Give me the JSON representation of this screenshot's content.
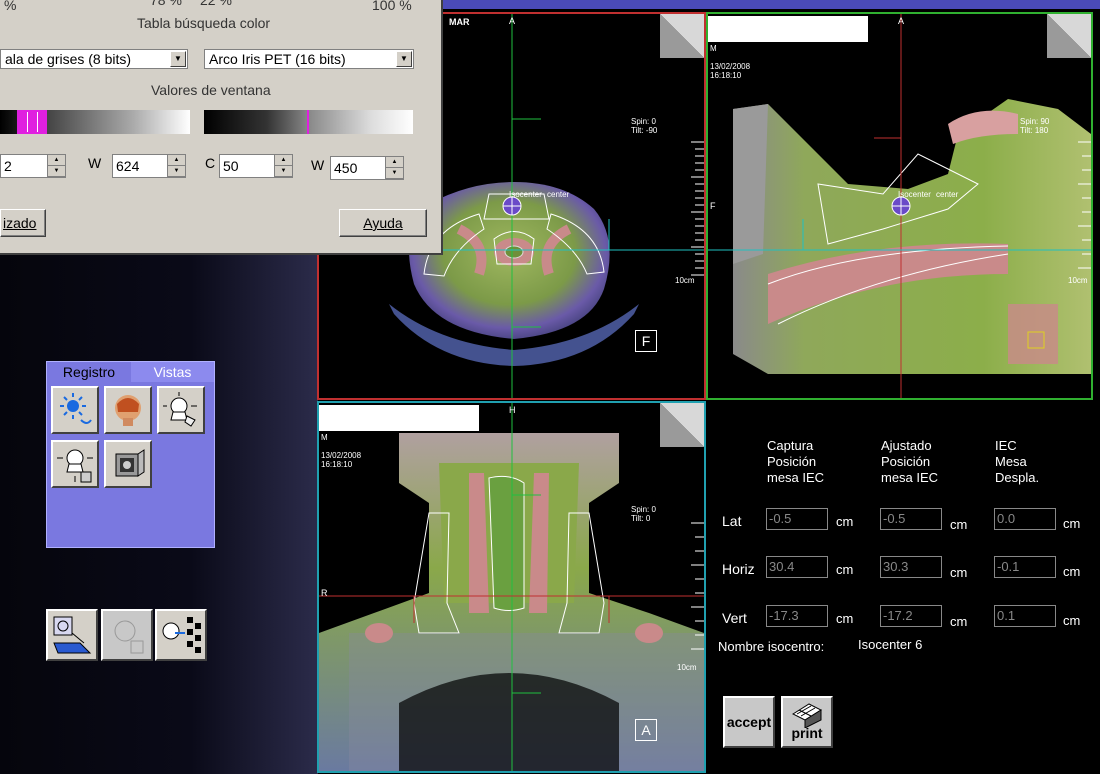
{
  "dialog": {
    "pct_left": "%",
    "pct_mid1": "78 %",
    "pct_mid2": "22 %",
    "pct_right": "100 %",
    "title": "Tabla búsqueda color",
    "lut_left": "ala de grises (8 bits)",
    "lut_right": "Arco Iris PET (16 bits)",
    "window_title": "Valores de ventana",
    "left_c_value": "2",
    "left_w_label": "W",
    "left_w_value": "624",
    "right_c_label": "C",
    "right_c_value": "50",
    "right_w_label": "W",
    "right_w_value": "450",
    "btn_left": "izado",
    "btn_help": "Ayuda"
  },
  "viewports": {
    "axial": {
      "label_mar": "MAR",
      "top_marker": "A",
      "spin": "Spin:  0",
      "tilt": "Tilt: -90",
      "iso": "Isocenter",
      "iso_suffix": "center",
      "scale": "10cm",
      "orientation": "F"
    },
    "sagittal": {
      "label_m": "M",
      "date": "13/02/2008",
      "time": "16:18:10",
      "top_marker": "A",
      "left_marker": "F",
      "spin": "Spin: 90",
      "tilt": "Tilt: 180",
      "iso": "Isocenter",
      "iso_suffix": "center",
      "scale": "10cm"
    },
    "coronal": {
      "label_m": "M",
      "date": "13/02/2008",
      "time": "16:18:10",
      "top_marker": "H",
      "left_marker": "R",
      "spin": "Spin:  0",
      "tilt": "Tilt:  0",
      "scale": "10cm",
      "orientation": "A"
    }
  },
  "tools": {
    "tab_registro": "Registro",
    "tab_vistas": "Vistas"
  },
  "table": {
    "col1": [
      "Captura",
      "Posición",
      "mesa IEC"
    ],
    "col2": [
      "Ajustado",
      "Posición",
      "mesa IEC"
    ],
    "col3": [
      "IEC",
      "Mesa",
      "Despla."
    ],
    "rows": [
      {
        "label": "Lat",
        "captura": "-0.5",
        "ajustado": "-0.5",
        "desplaz": "0.0"
      },
      {
        "label": "Horiz",
        "captura": "30.4",
        "ajustado": "30.3",
        "desplaz": "-0.1"
      },
      {
        "label": "Vert",
        "captura": "-17.3",
        "ajustado": "-17.2",
        "desplaz": "0.1"
      }
    ],
    "unit": "cm",
    "iso_label": "Nombre isocentro:",
    "iso_value": "Isocenter 6"
  },
  "buttons": {
    "accept": "accept",
    "print": "print"
  }
}
